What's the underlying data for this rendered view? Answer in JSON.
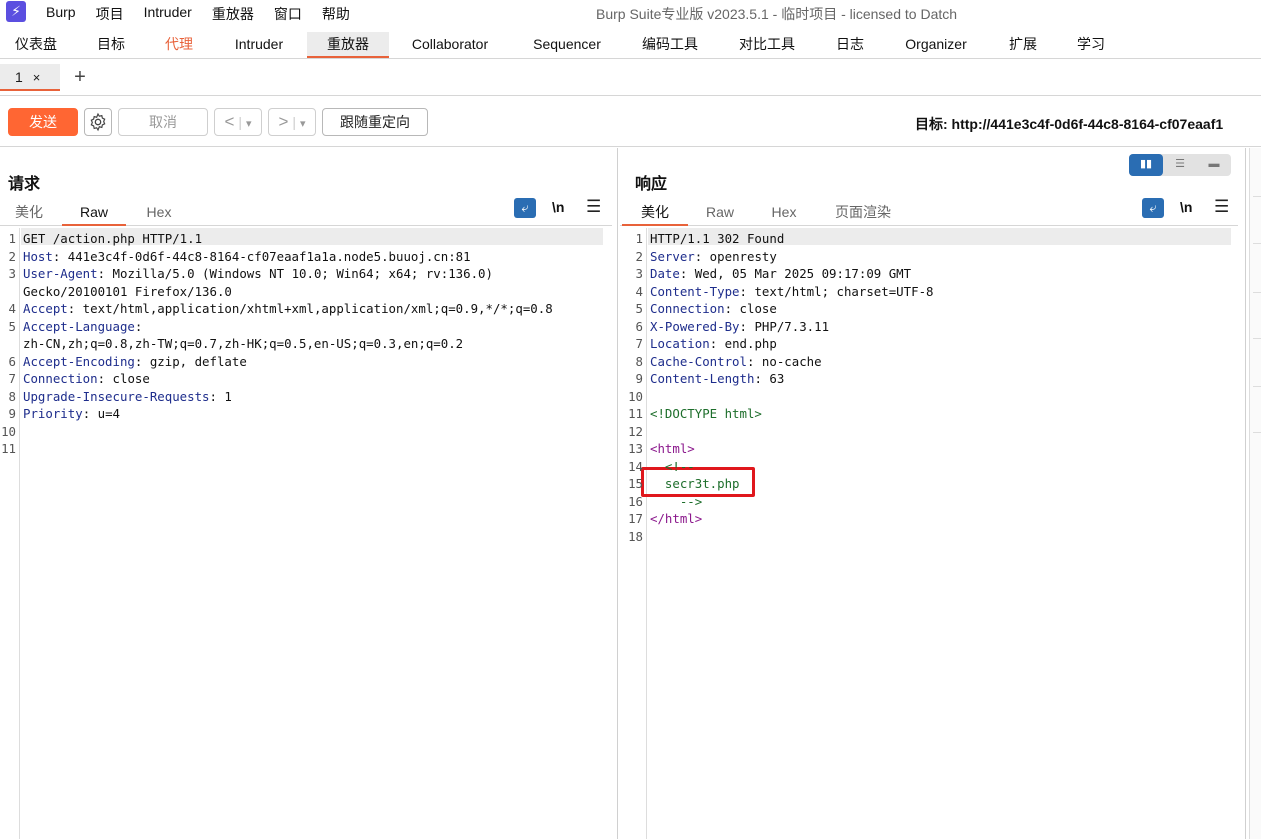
{
  "app": {
    "logo_glyph": "⚡",
    "menu": [
      "Burp",
      "项目",
      "Intruder",
      "重放器",
      "窗口",
      "帮助"
    ],
    "window_title": "Burp Suite专业版  v2023.5.1 - 临时项目 - licensed to Datch"
  },
  "main_tabs": [
    {
      "label": "仪表盘"
    },
    {
      "label": "目标"
    },
    {
      "label": "代理"
    },
    {
      "label": "Intruder"
    },
    {
      "label": "重放器"
    },
    {
      "label": "Collaborator"
    },
    {
      "label": "Sequencer"
    },
    {
      "label": "编码工具"
    },
    {
      "label": "对比工具"
    },
    {
      "label": "日志"
    },
    {
      "label": "Organizer"
    },
    {
      "label": "扩展"
    },
    {
      "label": "学习"
    }
  ],
  "repeater_tabs": {
    "tab1_label": "1",
    "close_glyph": "×",
    "add_glyph": "+"
  },
  "toolbar": {
    "send_label": "发送",
    "cancel_label": "取消",
    "back_glyph": "<",
    "forward_glyph": ">",
    "dropdown_glyph": "▾",
    "follow_redirect_label": "跟随重定向",
    "target_label": "目标: http://441e3c4f-0d6f-44c8-8164-cf07eaaf1"
  },
  "request": {
    "title": "请求",
    "tabs": [
      "美化",
      "Raw",
      "Hex"
    ],
    "wrap_glyph": "⤶",
    "newline_label": "\\n",
    "menu_glyph": "☰",
    "lines": [
      {
        "n": "1",
        "k": "",
        "v": "GET /action.php HTTP/1.1"
      },
      {
        "n": "2",
        "k": "Host",
        "v": ": 441e3c4f-0d6f-44c8-8164-cf07eaaf1a1a.node5.buuoj.cn:81"
      },
      {
        "n": "3",
        "k": "User-Agent",
        "v": ": Mozilla/5.0 (Windows NT 10.0; Win64; x64; rv:136.0)"
      },
      {
        "n": "",
        "k": "",
        "v": "Gecko/20100101 Firefox/136.0"
      },
      {
        "n": "4",
        "k": "Accept",
        "v": ": text/html,application/xhtml+xml,application/xml;q=0.9,*/*;q=0.8"
      },
      {
        "n": "5",
        "k": "Accept-Language",
        "v": ":"
      },
      {
        "n": "",
        "k": "",
        "v": "zh-CN,zh;q=0.8,zh-TW;q=0.7,zh-HK;q=0.5,en-US;q=0.3,en;q=0.2"
      },
      {
        "n": "6",
        "k": "Accept-Encoding",
        "v": ": gzip, deflate"
      },
      {
        "n": "7",
        "k": "Connection",
        "v": ": close"
      },
      {
        "n": "8",
        "k": "Upgrade-Insecure-Requests",
        "v": ": 1"
      },
      {
        "n": "9",
        "k": "Priority",
        "v": ": u=4"
      },
      {
        "n": "10",
        "k": "",
        "v": ""
      },
      {
        "n": "11",
        "k": "",
        "v": ""
      }
    ]
  },
  "response": {
    "title": "响应",
    "tabs": [
      "美化",
      "Raw",
      "Hex",
      "页面渲染"
    ],
    "layout_glyphs": [
      "▮▮",
      "☰",
      "▬"
    ],
    "wrap_glyph": "⤶",
    "newline_label": "\\n",
    "menu_glyph": "☰",
    "lines": [
      {
        "n": "1",
        "k": "",
        "v": "HTTP/1.1 302 Found",
        "cls": "hv"
      },
      {
        "n": "2",
        "k": "Server",
        "v": ": openresty",
        "cls": "hv"
      },
      {
        "n": "3",
        "k": "Date",
        "v": ": Wed, 05 Mar 2025 09:17:09 GMT",
        "cls": "hv"
      },
      {
        "n": "4",
        "k": "Content-Type",
        "v": ": text/html; charset=UTF-8",
        "cls": "hv"
      },
      {
        "n": "5",
        "k": "Connection",
        "v": ": close",
        "cls": "hv"
      },
      {
        "n": "6",
        "k": "X-Powered-By",
        "v": ": PHP/7.3.11",
        "cls": "hv"
      },
      {
        "n": "7",
        "k": "Location",
        "v": ": end.php",
        "cls": "hv"
      },
      {
        "n": "8",
        "k": "Cache-Control",
        "v": ": no-cache",
        "cls": "hv"
      },
      {
        "n": "9",
        "k": "Content-Length",
        "v": ": 63",
        "cls": "hv"
      },
      {
        "n": "10",
        "k": "",
        "v": "",
        "cls": "hv"
      },
      {
        "n": "11",
        "k": "",
        "v": "<!DOCTYPE html>",
        "cls": "tag"
      },
      {
        "n": "12",
        "k": "",
        "v": "",
        "cls": "hv"
      },
      {
        "n": "13",
        "k": "",
        "v": "<html>",
        "cls": "tagp"
      },
      {
        "n": "14",
        "k": "",
        "v": "  <!--",
        "cls": "tag"
      },
      {
        "n": "15",
        "k": "",
        "v": "  secr3t.php",
        "cls": "tag"
      },
      {
        "n": "16",
        "k": "",
        "v": "    -->",
        "cls": "tag"
      },
      {
        "n": "17",
        "k": "",
        "v": "</html>",
        "cls": "tagp"
      },
      {
        "n": "18",
        "k": "",
        "v": "",
        "cls": "hv"
      }
    ]
  },
  "colors": {
    "accent": "#e8623a",
    "send": "#ff6633",
    "highlight_box": "#e0171c",
    "header_key": "#1e2d8c",
    "html_comment": "#1d6e2b",
    "html_tag": "#8b188c"
  }
}
